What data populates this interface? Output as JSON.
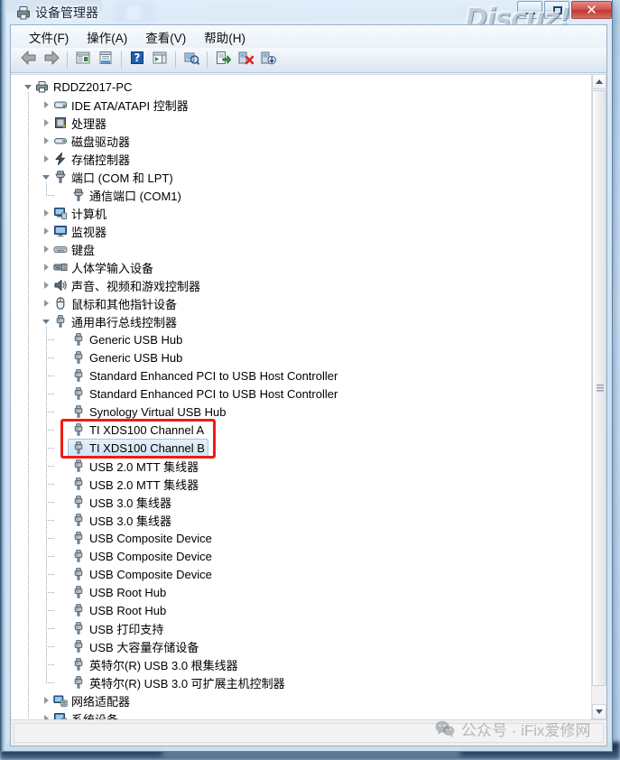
{
  "window": {
    "title": "设备管理器",
    "title_icon": "device-manager-icon",
    "minimize_label": "最小化",
    "maximize_label": "最大化",
    "close_label": "关闭",
    "close_glyph": "✕"
  },
  "watermarks": {
    "top_right": "Discuz!",
    "bottom_right": "公众号 · iFix爱修网",
    "bottom_right_icon": "wechat-icon"
  },
  "menubar": {
    "items": [
      {
        "label": "文件(F)",
        "name": "menu-file"
      },
      {
        "label": "操作(A)",
        "name": "menu-action"
      },
      {
        "label": "查看(V)",
        "name": "menu-view"
      },
      {
        "label": "帮助(H)",
        "name": "menu-help"
      }
    ]
  },
  "toolbar": {
    "items": [
      {
        "name": "back-button",
        "icon": "back-arrow-icon",
        "label": "后退"
      },
      {
        "name": "forward-button",
        "icon": "forward-arrow-icon",
        "label": "前进"
      },
      {
        "name": "separator-1",
        "icon": "separator",
        "label": ""
      },
      {
        "name": "show-hide-console-tree-button",
        "icon": "console-tree-icon",
        "label": "显示/隐藏控制台树"
      },
      {
        "name": "properties-button",
        "icon": "properties-icon",
        "label": "属性"
      },
      {
        "name": "separator-2",
        "icon": "separator",
        "label": ""
      },
      {
        "name": "help-button",
        "icon": "help-question-icon",
        "label": "帮助"
      },
      {
        "name": "show-hide-action-pane-button",
        "icon": "action-pane-icon",
        "label": "显示/隐藏操作窗格"
      },
      {
        "name": "separator-3",
        "icon": "separator",
        "label": ""
      },
      {
        "name": "scan-hardware-changes-button",
        "icon": "scan-hardware-icon",
        "label": "扫描检测硬件改动"
      },
      {
        "name": "separator-4",
        "icon": "separator",
        "label": ""
      },
      {
        "name": "update-driver-button",
        "icon": "update-driver-icon",
        "label": "更新驱动程序软件"
      },
      {
        "name": "uninstall-device-button",
        "icon": "uninstall-device-icon",
        "label": "卸载"
      },
      {
        "name": "disable-device-button",
        "icon": "disable-device-icon",
        "label": "禁用"
      }
    ]
  },
  "tree": {
    "rows": [
      {
        "label": "RDDZ2017-PC",
        "depth": 0,
        "state": "expanded",
        "icon": "computer-root-icon",
        "selected": false
      },
      {
        "label": "IDE ATA/ATAPI 控制器",
        "depth": 1,
        "state": "collapsed",
        "icon": "ide-controller-icon",
        "selected": false
      },
      {
        "label": "处理器",
        "depth": 1,
        "state": "collapsed",
        "icon": "processor-icon",
        "selected": false
      },
      {
        "label": "磁盘驱动器",
        "depth": 1,
        "state": "collapsed",
        "icon": "disk-drive-icon",
        "selected": false
      },
      {
        "label": "存储控制器",
        "depth": 1,
        "state": "collapsed",
        "icon": "storage-controller-icon",
        "selected": false
      },
      {
        "label": "端口 (COM 和 LPT)",
        "depth": 1,
        "state": "expanded",
        "icon": "port-icon",
        "selected": false
      },
      {
        "label": "通信端口 (COM1)",
        "depth": 2,
        "state": "none",
        "icon": "port-icon",
        "selected": false
      },
      {
        "label": "计算机",
        "depth": 1,
        "state": "collapsed",
        "icon": "computer-icon",
        "selected": false
      },
      {
        "label": "监视器",
        "depth": 1,
        "state": "collapsed",
        "icon": "monitor-icon",
        "selected": false
      },
      {
        "label": "键盘",
        "depth": 1,
        "state": "collapsed",
        "icon": "keyboard-icon",
        "selected": false
      },
      {
        "label": "人体学输入设备",
        "depth": 1,
        "state": "collapsed",
        "icon": "hid-icon",
        "selected": false
      },
      {
        "label": "声音、视频和游戏控制器",
        "depth": 1,
        "state": "collapsed",
        "icon": "sound-icon",
        "selected": false
      },
      {
        "label": "鼠标和其他指针设备",
        "depth": 1,
        "state": "collapsed",
        "icon": "mouse-icon",
        "selected": false
      },
      {
        "label": "通用串行总线控制器",
        "depth": 1,
        "state": "expanded",
        "icon": "usb-icon",
        "selected": false
      },
      {
        "label": "Generic USB Hub",
        "depth": 2,
        "state": "none",
        "icon": "usb-icon",
        "selected": false
      },
      {
        "label": "Generic USB Hub",
        "depth": 2,
        "state": "none",
        "icon": "usb-icon",
        "selected": false
      },
      {
        "label": "Standard Enhanced PCI to USB Host Controller",
        "depth": 2,
        "state": "none",
        "icon": "usb-icon",
        "selected": false
      },
      {
        "label": "Standard Enhanced PCI to USB Host Controller",
        "depth": 2,
        "state": "none",
        "icon": "usb-icon",
        "selected": false
      },
      {
        "label": "Synology Virtual USB Hub",
        "depth": 2,
        "state": "none",
        "icon": "usb-icon",
        "selected": false
      },
      {
        "label": "TI XDS100 Channel A",
        "depth": 2,
        "state": "none",
        "icon": "usb-icon",
        "selected": false
      },
      {
        "label": "TI XDS100 Channel B",
        "depth": 2,
        "state": "none",
        "icon": "usb-icon",
        "selected": true
      },
      {
        "label": "USB 2.0 MTT 集线器",
        "depth": 2,
        "state": "none",
        "icon": "usb-icon",
        "selected": false
      },
      {
        "label": "USB 2.0 MTT 集线器",
        "depth": 2,
        "state": "none",
        "icon": "usb-icon",
        "selected": false
      },
      {
        "label": "USB 3.0 集线器",
        "depth": 2,
        "state": "none",
        "icon": "usb-icon",
        "selected": false
      },
      {
        "label": "USB 3.0 集线器",
        "depth": 2,
        "state": "none",
        "icon": "usb-icon",
        "selected": false
      },
      {
        "label": "USB Composite Device",
        "depth": 2,
        "state": "none",
        "icon": "usb-icon",
        "selected": false
      },
      {
        "label": "USB Composite Device",
        "depth": 2,
        "state": "none",
        "icon": "usb-icon",
        "selected": false
      },
      {
        "label": "USB Composite Device",
        "depth": 2,
        "state": "none",
        "icon": "usb-icon",
        "selected": false
      },
      {
        "label": "USB Root Hub",
        "depth": 2,
        "state": "none",
        "icon": "usb-icon",
        "selected": false
      },
      {
        "label": "USB Root Hub",
        "depth": 2,
        "state": "none",
        "icon": "usb-icon",
        "selected": false
      },
      {
        "label": "USB 打印支持",
        "depth": 2,
        "state": "none",
        "icon": "usb-icon",
        "selected": false
      },
      {
        "label": "USB 大容量存储设备",
        "depth": 2,
        "state": "none",
        "icon": "usb-icon",
        "selected": false
      },
      {
        "label": "英特尔(R) USB 3.0 根集线器",
        "depth": 2,
        "state": "none",
        "icon": "usb-icon",
        "selected": false
      },
      {
        "label": "英特尔(R) USB 3.0 可扩展主机控制器",
        "depth": 2,
        "state": "none",
        "icon": "usb-icon",
        "selected": false
      },
      {
        "label": "网络适配器",
        "depth": 1,
        "state": "collapsed",
        "icon": "network-adapter-icon",
        "selected": false
      },
      {
        "label": "系统设备",
        "depth": 1,
        "state": "collapsed",
        "icon": "system-device-icon",
        "selected": false
      }
    ],
    "highlight_box": {
      "name": "red-annotation-box",
      "color": "#ee1c14",
      "rows": [
        "TI XDS100 Channel A",
        "TI XDS100 Channel B"
      ]
    }
  },
  "scrollbar": {
    "up_label": "向上滚动",
    "down_label": "向下滚动",
    "thumb_label": "垂直滚动滑块"
  },
  "statusbar": {
    "text": ""
  },
  "colors": {
    "selection_border": "#9fc6e8",
    "selection_fill": "#cfe4f7",
    "annotation_red": "#ee1c14",
    "window_frame": "#5b7fa6"
  }
}
